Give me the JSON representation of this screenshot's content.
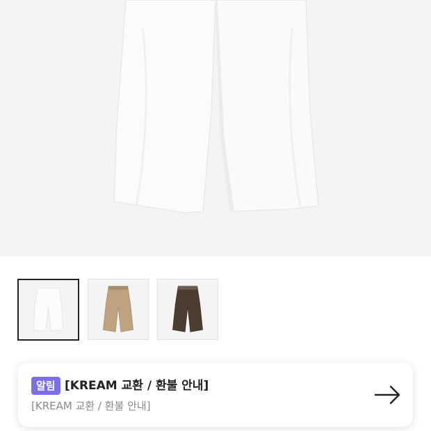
{
  "product": {
    "main_image": "white-wide-pants-photo",
    "thumbnails": [
      {
        "color_name": "white",
        "fill": "#f6f6f6",
        "selected": true
      },
      {
        "color_name": "beige",
        "fill": "#bfa27f",
        "selected": false
      },
      {
        "color_name": "dark-brown",
        "fill": "#4b3d2f",
        "selected": false
      }
    ]
  },
  "notice": {
    "badge": "알림",
    "title": "[KREAM 교환 / 환불 안내]",
    "subtitle": "[KREAM 교환 / 환불 안내]",
    "arrow_icon": "arrow-right-icon"
  },
  "colors": {
    "badge": "#7b6ee8",
    "hero_bg": "#f4f4f4"
  }
}
